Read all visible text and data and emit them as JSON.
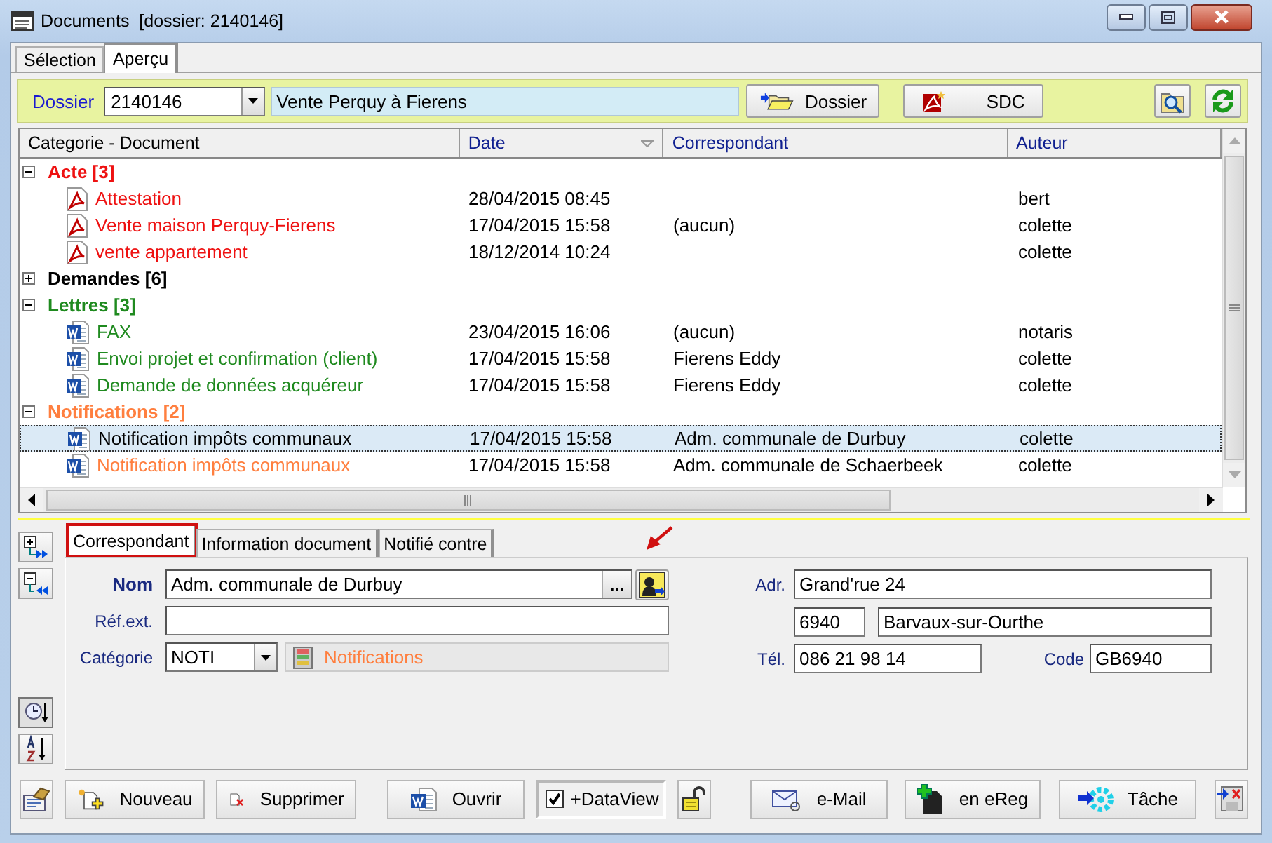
{
  "window": {
    "title": "Documents  [dossier: 2140146]"
  },
  "tabs": [
    {
      "label": "Sélection",
      "selected": false
    },
    {
      "label": "Aperçu",
      "selected": true
    }
  ],
  "dossier_bar": {
    "label": "Dossier",
    "number": "2140146",
    "description": "Vente Perquy à Fierens",
    "buttons": [
      {
        "kind": "folder",
        "label": "Dossier"
      },
      {
        "kind": "pdf",
        "label": "SDC"
      },
      {
        "kind": "search"
      },
      {
        "kind": "refresh"
      }
    ]
  },
  "grid": {
    "columns": [
      {
        "label": "Categorie - Document",
        "sorted": false
      },
      {
        "label": "Date",
        "sorted": true
      },
      {
        "label": "Correspondant",
        "sorted": false
      },
      {
        "label": "Auteur",
        "sorted": false
      }
    ],
    "groups": [
      {
        "label": "Acte [3]",
        "color": "#ee1111",
        "expanded": true,
        "children": [
          {
            "kind": "pdf",
            "name": "Attestation",
            "date": "28/04/2015 08:45",
            "author": "bert",
            "selected": false
          },
          {
            "kind": "pdf",
            "name": "Vente maison Perquy-Fierens",
            "date": "17/04/2015 15:58",
            "correspondent": "(aucun)",
            "author": "colette",
            "selected": false
          },
          {
            "kind": "pdf",
            "name": "vente appartement",
            "date": "18/12/2014 10:24",
            "author": "colette",
            "selected": false
          }
        ]
      },
      {
        "label": "Demandes [6]",
        "color": "#000000",
        "expanded": false
      },
      {
        "label": "Lettres [3]",
        "color": "#1f8a1f",
        "expanded": true,
        "children": [
          {
            "kind": "word",
            "name": "FAX",
            "date": "23/04/2015 16:06",
            "correspondent": "(aucun)",
            "author": "notaris",
            "selected": false
          },
          {
            "kind": "word",
            "name": "Envoi projet et confirmation (client)",
            "date": "17/04/2015 15:58",
            "correspondent": "Fierens Eddy",
            "author": "colette",
            "selected": false
          },
          {
            "kind": "word",
            "name": "Demande de données acquéreur",
            "date": "17/04/2015 15:58",
            "correspondent": "Fierens Eddy",
            "author": "colette",
            "selected": false
          }
        ]
      },
      {
        "label": "Notifications [2]",
        "color": "#ff7f3f",
        "expanded": true,
        "children": [
          {
            "kind": "word",
            "name": "Notification impôts communaux",
            "date": "17/04/2015 15:58",
            "correspondent": "Adm. communale de Durbuy",
            "author": "colette",
            "selected": true
          },
          {
            "kind": "word",
            "name": "Notification impôts communaux",
            "date": "17/04/2015 15:58",
            "correspondent": "Adm. communale de Schaerbeek",
            "author": "colette",
            "selected": false
          }
        ]
      }
    ]
  },
  "detail": {
    "tabs": [
      {
        "label": "Correspondant",
        "selected": true,
        "highlighted": true
      },
      {
        "label": "Information document",
        "selected": false,
        "highlighted": false
      },
      {
        "label": "Notifié contre",
        "selected": false,
        "highlighted": false
      }
    ],
    "name": {
      "label": "Nom",
      "value": "Adm. communale de Durbuy",
      "button": "..."
    },
    "reference": {
      "label": "Réf.ext."
    },
    "category": {
      "label": "Catégorie",
      "value": "NOTI",
      "description": "Notifications"
    },
    "address": {
      "label": "Adr.",
      "street": "Grand'rue 24",
      "postcode": "6940",
      "city": "Barvaux-sur-Ourthe"
    },
    "phone": {
      "label": "Tél.",
      "value": "086 21 98 14"
    },
    "code": {
      "label": "Code",
      "value": "GB6940"
    }
  },
  "actions": [
    {
      "kind": "properties"
    },
    {
      "kind": "new",
      "label": "Nouveau"
    },
    {
      "kind": "delete",
      "label": "Supprimer"
    },
    {
      "kind": "open",
      "label": "Ouvrir"
    },
    {
      "kind": "checkbox",
      "label": "+DataView",
      "checked": true
    },
    {
      "kind": "lock"
    },
    {
      "kind": "email",
      "label": "e-Mail"
    },
    {
      "kind": "ereg",
      "label": "en eReg"
    },
    {
      "kind": "task",
      "label": "Tâche"
    },
    {
      "kind": "export"
    }
  ]
}
